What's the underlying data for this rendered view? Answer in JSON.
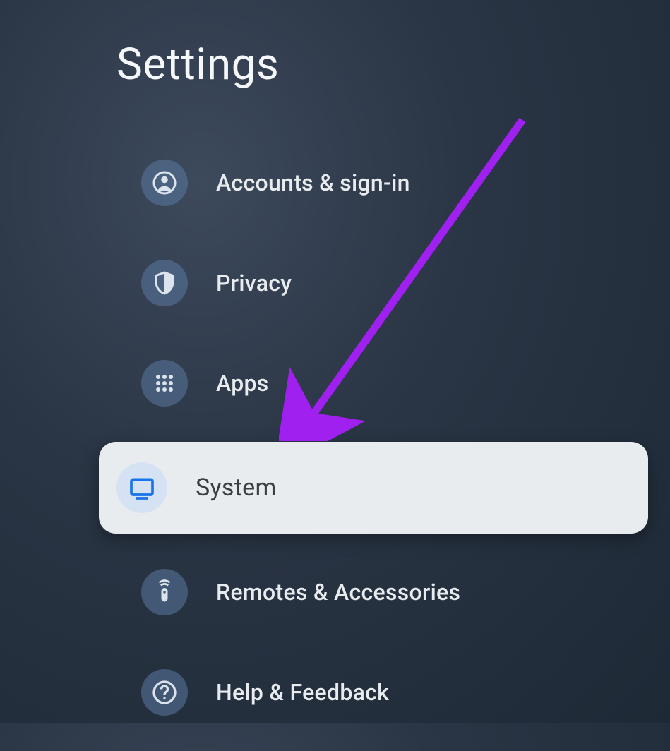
{
  "title": "Settings",
  "menu": {
    "items": [
      {
        "id": "accounts",
        "label": "Accounts & sign-in",
        "icon": "account-icon",
        "selected": false
      },
      {
        "id": "privacy",
        "label": "Privacy",
        "icon": "shield-icon",
        "selected": false
      },
      {
        "id": "apps",
        "label": "Apps",
        "icon": "apps-grid-icon",
        "selected": false
      },
      {
        "id": "system",
        "label": "System",
        "icon": "monitor-icon",
        "selected": true
      },
      {
        "id": "remotes",
        "label": "Remotes & Accessories",
        "icon": "remote-icon",
        "selected": false
      },
      {
        "id": "help",
        "label": "Help & Feedback",
        "icon": "help-icon",
        "selected": false
      }
    ]
  },
  "annotation": {
    "arrow_color": "#a020f0",
    "target": "system"
  },
  "colors": {
    "bg_dark": "#1e2936",
    "icon_bg": "rgba(90,120,160,0.55)",
    "selected_bg": "#e8ecef",
    "selected_icon_bg": "#d4e2f4",
    "selected_icon_fg": "#1a73e8",
    "text_light": "#e8ecef",
    "text_dark": "#3a3f45"
  }
}
